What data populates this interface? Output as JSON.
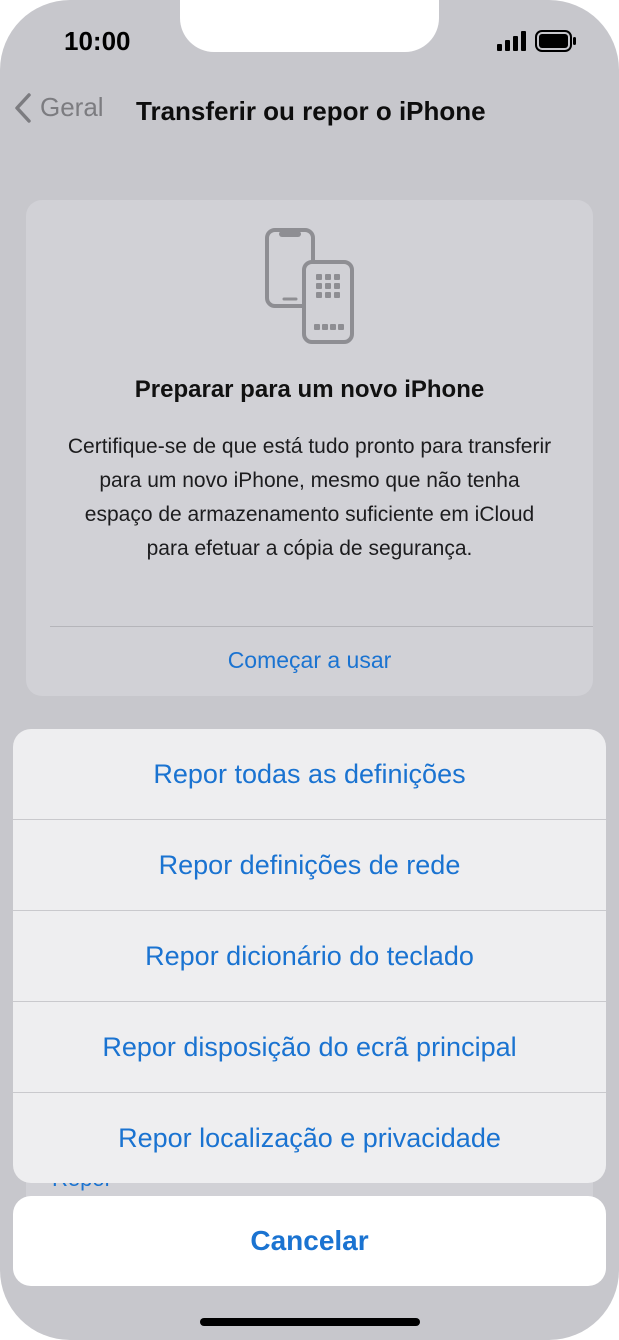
{
  "status_bar": {
    "time": "10:00"
  },
  "nav": {
    "back_label": "Geral",
    "title": "Transferir ou repor o iPhone"
  },
  "card": {
    "title": "Preparar para um novo iPhone",
    "description": "Certifique-se de que está tudo pronto para transferir para um novo iPhone, mesmo que não tenha espaço de armazenamento suficiente em iCloud para efetuar a cópia de segurança.",
    "action": "Começar a usar"
  },
  "behind_text": "Repor",
  "action_sheet": {
    "items": [
      {
        "label": "Repor todas as definições"
      },
      {
        "label": "Repor definições de rede"
      },
      {
        "label": "Repor dicionário do teclado"
      },
      {
        "label": "Repor disposição do ecrã principal"
      },
      {
        "label": "Repor localização e privacidade"
      }
    ],
    "cancel_label": "Cancelar"
  },
  "colors": {
    "accent": "#1a73d1",
    "dim_background": "#c7c7cc",
    "sheet_background": "#eeeef0"
  }
}
